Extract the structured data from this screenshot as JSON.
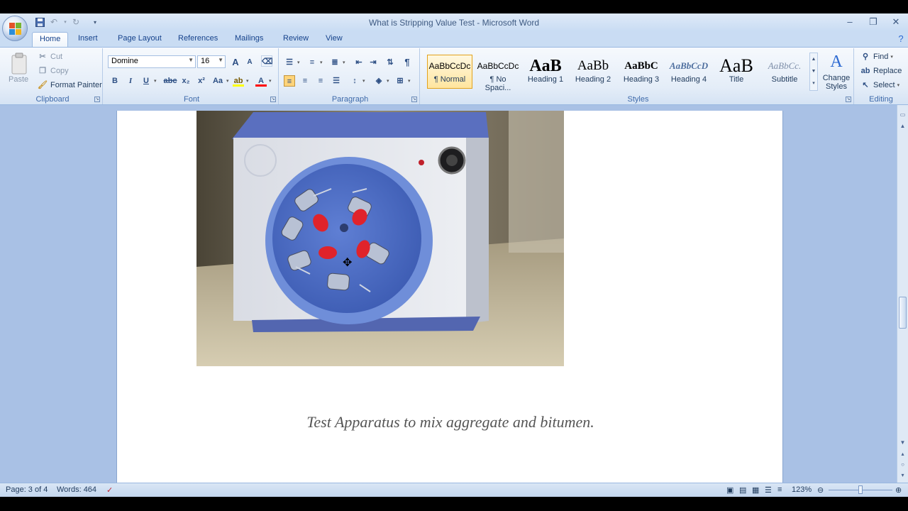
{
  "window": {
    "title": "What is Stripping Value Test - Microsoft Word"
  },
  "ribbon_tabs": [
    "Home",
    "Insert",
    "Page Layout",
    "References",
    "Mailings",
    "Review",
    "View"
  ],
  "clipboard": {
    "paste": "Paste",
    "cut": "Cut",
    "copy": "Copy",
    "format_painter": "Format Painter",
    "label": "Clipboard"
  },
  "font": {
    "name": "Domine",
    "size": "16",
    "label": "Font",
    "bold": "B",
    "italic": "I",
    "underline": "U",
    "strike": "abc",
    "subscript": "x₂",
    "superscript": "x²",
    "change_case": "Aa",
    "grow": "A",
    "shrink": "A"
  },
  "paragraph": {
    "label": "Paragraph",
    "pilcrow": "¶"
  },
  "styles": {
    "label": "Styles",
    "items": [
      {
        "sample": "AaBbCcDc",
        "name": "¶ Normal"
      },
      {
        "sample": "AaBbCcDc",
        "name": "¶ No Spaci..."
      },
      {
        "sample": "AaB",
        "name": "Heading 1"
      },
      {
        "sample": "AaBb",
        "name": "Heading 2"
      },
      {
        "sample": "AaBbC",
        "name": "Heading 3"
      },
      {
        "sample": "AaBbCcD",
        "name": "Heading 4"
      },
      {
        "sample": "AaB",
        "name": "Title"
      },
      {
        "sample": "AaBbCc.",
        "name": "Subtitle"
      }
    ],
    "change_styles": "Change Styles"
  },
  "editing": {
    "label": "Editing",
    "find": "Find",
    "replace": "Replace",
    "select": "Select"
  },
  "document": {
    "caption": "Test Apparatus to mix aggregate and bitumen."
  },
  "status": {
    "page": "Page: 3 of 4",
    "words": "Words: 464",
    "zoom": "123%"
  },
  "colors": {
    "ribbon_bg": "#dbe7f6",
    "workspace_bg": "#a9c1e5",
    "page_bg": "#ffffff",
    "accent_selected_style": "#ffe59f",
    "highlight_color": "#ffff00",
    "font_color": "#ff0000"
  }
}
